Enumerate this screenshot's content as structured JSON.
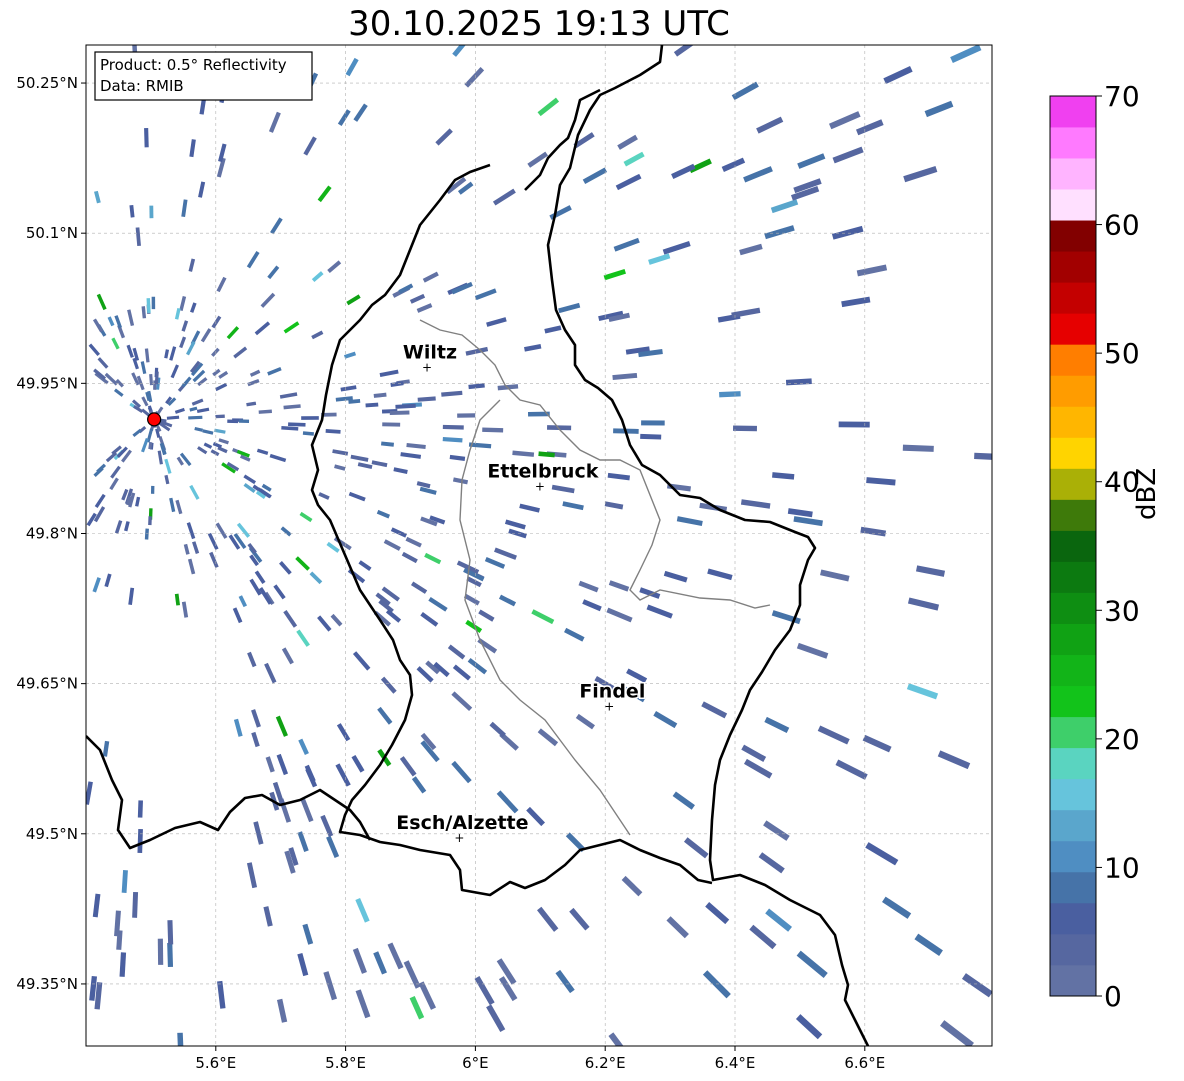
{
  "title": "30.10.2025 19:13 UTC",
  "infobox": {
    "product": "Product: 0.5° Reflectivity",
    "source": "Data: RMIB"
  },
  "axes": {
    "lat_ticks": [
      "50.25°N",
      "50.1°N",
      "49.95°N",
      "49.8°N",
      "49.65°N",
      "49.5°N",
      "49.35°N"
    ],
    "lon_ticks": [
      "5.6°E",
      "5.8°E",
      "6°E",
      "6.2°E",
      "6.4°E",
      "6.6°E"
    ]
  },
  "cities": [
    {
      "name": "Wiltz",
      "lon": 5.93,
      "lat": 49.966
    },
    {
      "name": "Ettelbruck",
      "lon": 6.104,
      "lat": 49.847
    },
    {
      "name": "Findel",
      "lon": 6.211,
      "lat": 49.627
    },
    {
      "name": "Esch/Alzette",
      "lon": 5.98,
      "lat": 49.496
    }
  ],
  "radar_site": {
    "lon": 5.505,
    "lat": 49.914,
    "color": "#ff0000"
  },
  "colorbar": {
    "label": "dBZ",
    "ticks": [
      "0",
      "10",
      "20",
      "30",
      "40",
      "50",
      "60",
      "70"
    ],
    "colors": [
      "#6272a4",
      "#5667a0",
      "#4a5fa0",
      "#4673a8",
      "#4f8ec2",
      "#5aa6cc",
      "#66c4dc",
      "#5ad4c0",
      "#3ecf6a",
      "#12c31a",
      "#12b418",
      "#10a214",
      "#0e8e12",
      "#0c7a10",
      "#0a660e",
      "#3e7a0a",
      "#aab006",
      "#ffd400",
      "#ffb600",
      "#ff9c00",
      "#ff7e00",
      "#e60000",
      "#c40000",
      "#a20000",
      "#820000",
      "#ffe0ff",
      "#ffb4ff",
      "#ff7aff",
      "#f040f0"
    ]
  }
}
